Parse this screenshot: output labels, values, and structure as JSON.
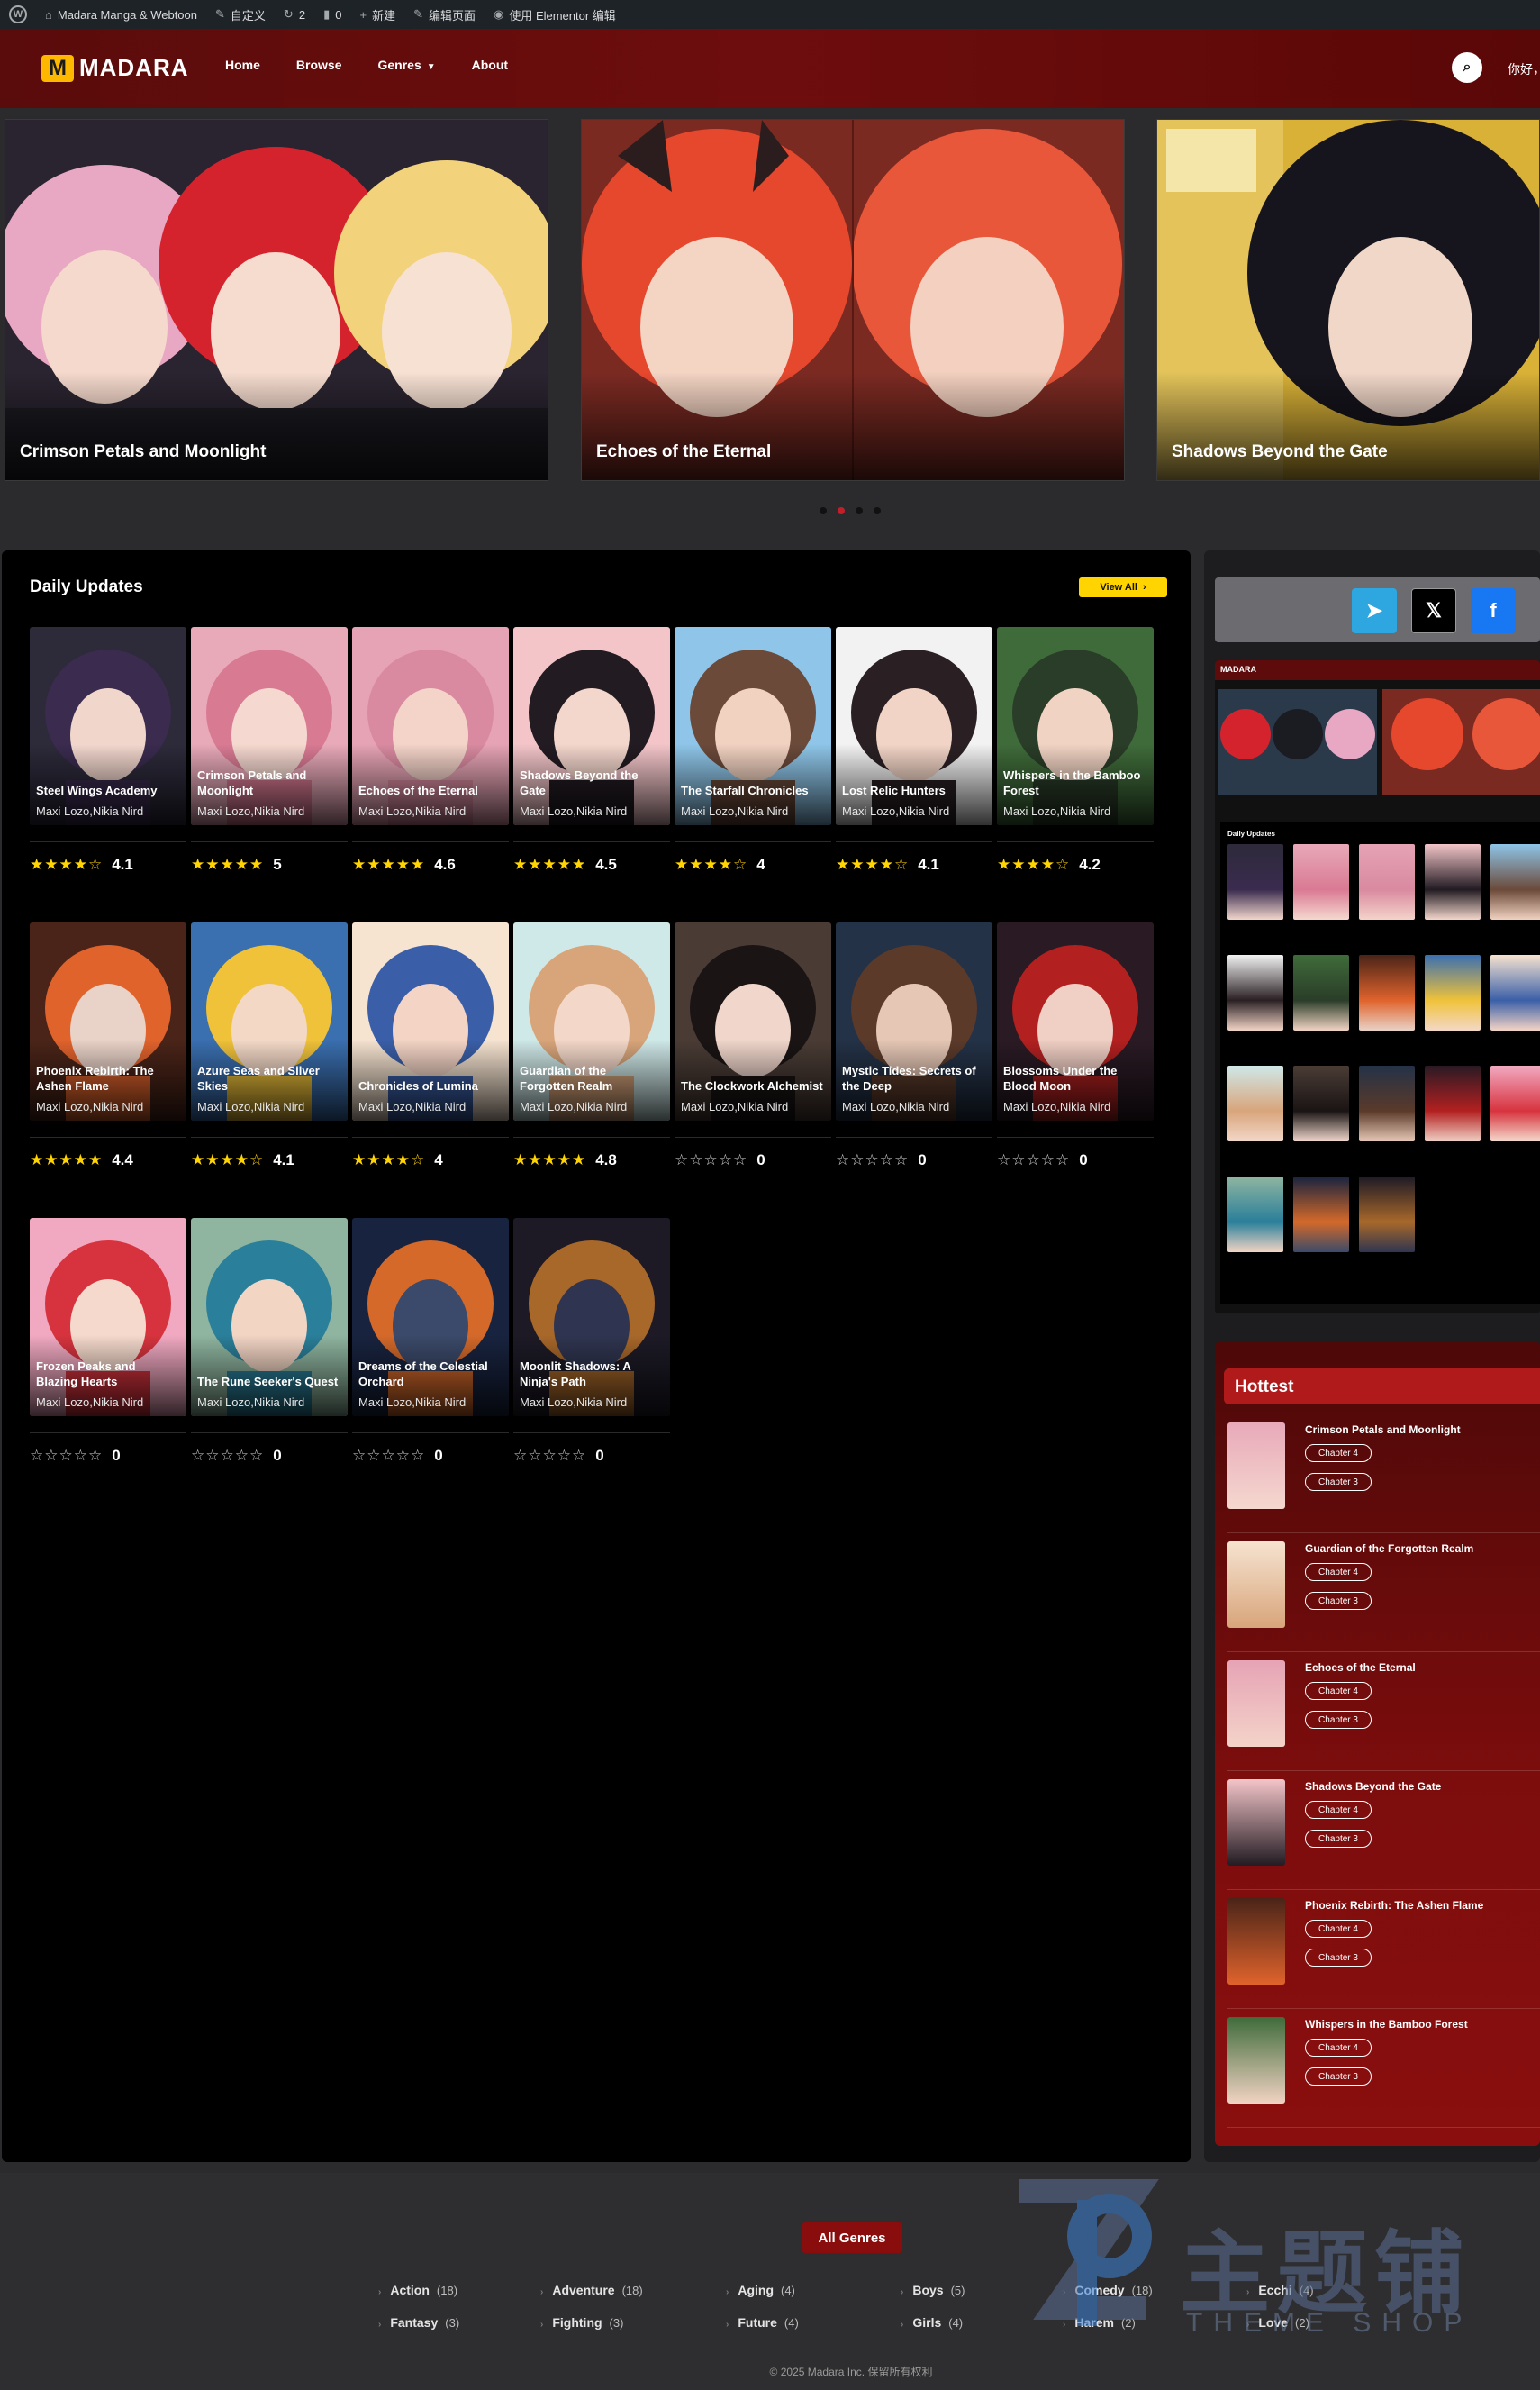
{
  "admin_bar": {
    "site_name": "Madara Manga & Webtoon",
    "customize": "自定义",
    "updates": "2",
    "comments": "0",
    "new": "新建",
    "edit_page": "编辑页面",
    "elementor": "使用 Elementor 编辑"
  },
  "header": {
    "logo_text": "MADARA",
    "logo_mark": "M",
    "nav": [
      "Home",
      "Browse",
      "Genres",
      "About"
    ],
    "greeting": "你好，"
  },
  "slider": {
    "slides": [
      "Crimson Petals and Moonlight",
      "Echoes of the Eternal",
      "Shadows Beyond the Gate"
    ],
    "dots": 4,
    "active_dot": 1
  },
  "daily": {
    "title": "Daily Updates",
    "view_all": "View All",
    "items": [
      {
        "title": "Steel Wings Academy",
        "author": "Maxi Lozo,Nikia Nird",
        "stars": "★★★★☆",
        "score": "4.1",
        "empty": false
      },
      {
        "title": "Crimson Petals and Moonlight",
        "author": "Maxi Lozo,Nikia Nird",
        "stars": "★★★★★",
        "score": "5",
        "empty": false
      },
      {
        "title": "Echoes of the Eternal",
        "author": "Maxi Lozo,Nikia Nird",
        "stars": "★★★★★",
        "score": "4.6",
        "empty": false
      },
      {
        "title": "Shadows Beyond the Gate",
        "author": "Maxi Lozo,Nikia Nird",
        "stars": "★★★★★",
        "score": "4.5",
        "empty": false
      },
      {
        "title": "The Starfall Chronicles",
        "author": "Maxi Lozo,Nikia Nird",
        "stars": "★★★★☆",
        "score": "4",
        "empty": false
      },
      {
        "title": "Lost Relic Hunters",
        "author": "Maxi Lozo,Nikia Nird",
        "stars": "★★★★☆",
        "score": "4.1",
        "empty": false
      },
      {
        "title": "Whispers in the Bamboo Forest",
        "author": "Maxi Lozo,Nikia Nird",
        "stars": "★★★★☆",
        "score": "4.2",
        "empty": false
      },
      {
        "title": "Phoenix Rebirth: The Ashen Flame",
        "author": "Maxi Lozo,Nikia Nird",
        "stars": "★★★★★",
        "score": "4.4",
        "empty": false
      },
      {
        "title": "Azure Seas and Silver Skies",
        "author": "Maxi Lozo,Nikia Nird",
        "stars": "★★★★☆",
        "score": "4.1",
        "empty": false
      },
      {
        "title": "Chronicles of Lumina",
        "author": "Maxi Lozo,Nikia Nird",
        "stars": "★★★★☆",
        "score": "4",
        "empty": false
      },
      {
        "title": "Guardian of the Forgotten Realm",
        "author": "Maxi Lozo,Nikia Nird",
        "stars": "★★★★★",
        "score": "4.8",
        "empty": false
      },
      {
        "title": "The Clockwork Alchemist",
        "author": "Maxi Lozo,Nikia Nird",
        "stars": "☆☆☆☆☆",
        "score": "0",
        "empty": true
      },
      {
        "title": "Mystic Tides: Secrets of the Deep",
        "author": "Maxi Lozo,Nikia Nird",
        "stars": "☆☆☆☆☆",
        "score": "0",
        "empty": true
      },
      {
        "title": "Blossoms Under the Blood Moon",
        "author": "Maxi Lozo,Nikia Nird",
        "stars": "☆☆☆☆☆",
        "score": "0",
        "empty": true
      },
      {
        "title": "Frozen Peaks and Blazing Hearts",
        "author": "Maxi Lozo,Nikia Nird",
        "stars": "☆☆☆☆☆",
        "score": "0",
        "empty": true
      },
      {
        "title": "The Rune Seeker's Quest",
        "author": "Maxi Lozo,Nikia Nird",
        "stars": "☆☆☆☆☆",
        "score": "0",
        "empty": true
      },
      {
        "title": "Dreams of the Celestial Orchard",
        "author": "Maxi Lozo,Nikia Nird",
        "stars": "☆☆☆☆☆",
        "score": "0",
        "empty": true
      },
      {
        "title": "Moonlit Shadows: A Ninja's Path",
        "author": "Maxi Lozo,Nikia Nird",
        "stars": "☆☆☆☆☆",
        "score": "0",
        "empty": true
      }
    ]
  },
  "sidebar": {
    "social": [
      {
        "name": "telegram-icon",
        "glyph": "➤",
        "color": "#2ea6e0"
      },
      {
        "name": "x-icon",
        "glyph": "𝕏",
        "color": "#000000"
      },
      {
        "name": "facebook-icon",
        "glyph": "f",
        "color": "#1877f2"
      }
    ],
    "preview_logo": "MADARA",
    "preview_heading": "Daily Updates",
    "hottest": {
      "title": "Hottest",
      "items": [
        {
          "name": "Crimson Petals and Moonlight",
          "chapters": [
            "Chapter 4",
            "Chapter 3"
          ]
        },
        {
          "name": "Guardian of the Forgotten Realm",
          "chapters": [
            "Chapter 4",
            "Chapter 3"
          ]
        },
        {
          "name": "Echoes of the Eternal",
          "chapters": [
            "Chapter 4",
            "Chapter 3"
          ]
        },
        {
          "name": "Shadows Beyond the Gate",
          "chapters": [
            "Chapter 4",
            "Chapter 3"
          ]
        },
        {
          "name": "Phoenix Rebirth: The Ashen Flame",
          "chapters": [
            "Chapter 4",
            "Chapter 3"
          ]
        },
        {
          "name": "Whispers in the Bamboo Forest",
          "chapters": [
            "Chapter 4",
            "Chapter 3"
          ]
        }
      ]
    }
  },
  "footer": {
    "genres_title": "All Genres",
    "genres": [
      {
        "name": "Action",
        "count": "(18)"
      },
      {
        "name": "Adventure",
        "count": "(18)"
      },
      {
        "name": "Aging",
        "count": "(4)"
      },
      {
        "name": "Boys",
        "count": "(5)"
      },
      {
        "name": "Comedy",
        "count": "(18)"
      },
      {
        "name": "Ecchi",
        "count": "(4)"
      },
      {
        "name": "Fantasy",
        "count": "(3)"
      },
      {
        "name": "Fighting",
        "count": "(3)"
      },
      {
        "name": "Future",
        "count": "(4)"
      },
      {
        "name": "Girls",
        "count": "(4)"
      },
      {
        "name": "Harem",
        "count": "(2)"
      },
      {
        "name": "Love",
        "count": "(2)"
      }
    ],
    "copyright": "© 2025 Madara Inc. 保留所有权利",
    "watermark_text": "主题铺",
    "watermark_sub": "THEME SHOP"
  }
}
